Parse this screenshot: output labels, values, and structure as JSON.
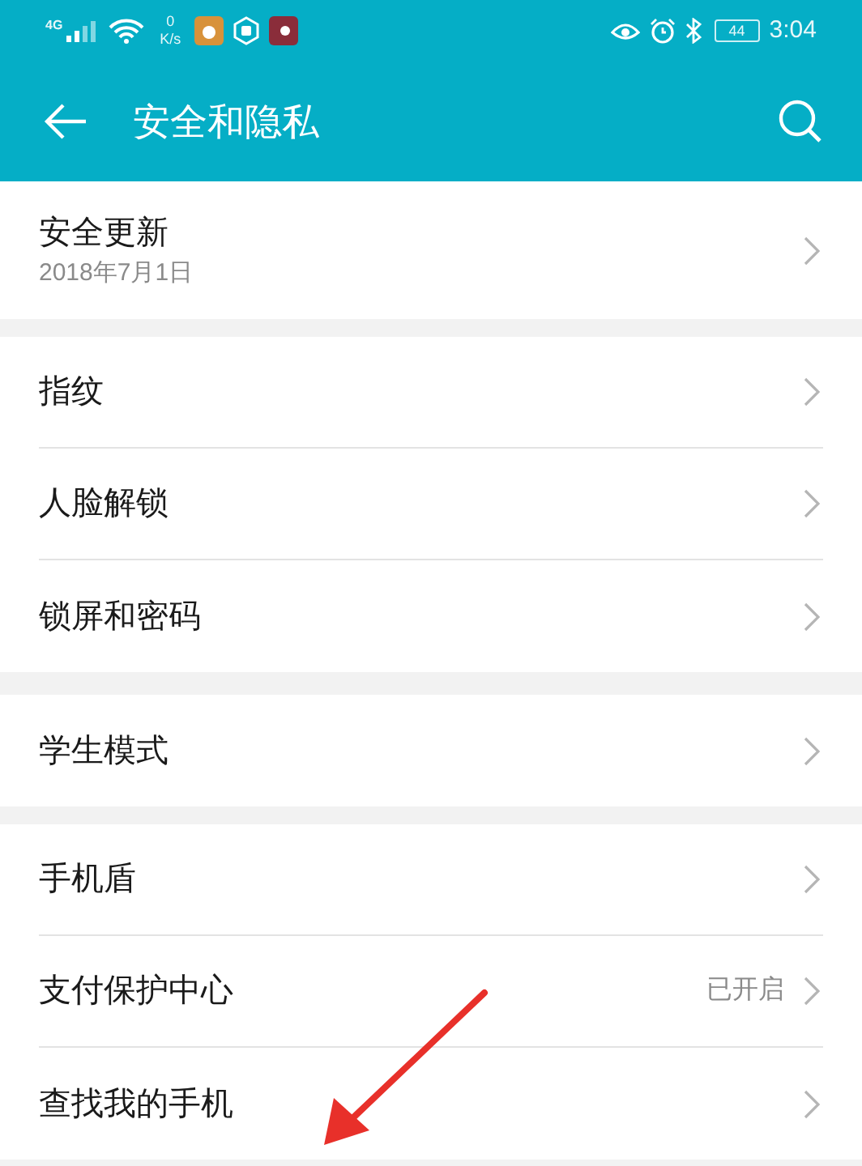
{
  "status_bar": {
    "network": "4G",
    "speed_value": "0",
    "speed_unit": "K/s",
    "battery": "44",
    "time": "3:04"
  },
  "toolbar": {
    "title": "安全和隐私"
  },
  "groups": [
    [
      {
        "title": "安全更新",
        "subtitle": "2018年7月1日"
      }
    ],
    [
      {
        "title": "指纹"
      },
      {
        "title": "人脸解锁"
      },
      {
        "title": "锁屏和密码"
      }
    ],
    [
      {
        "title": "学生模式"
      }
    ],
    [
      {
        "title": "手机盾"
      },
      {
        "title": "支付保护中心",
        "value": "已开启"
      },
      {
        "title": "查找我的手机"
      }
    ]
  ]
}
